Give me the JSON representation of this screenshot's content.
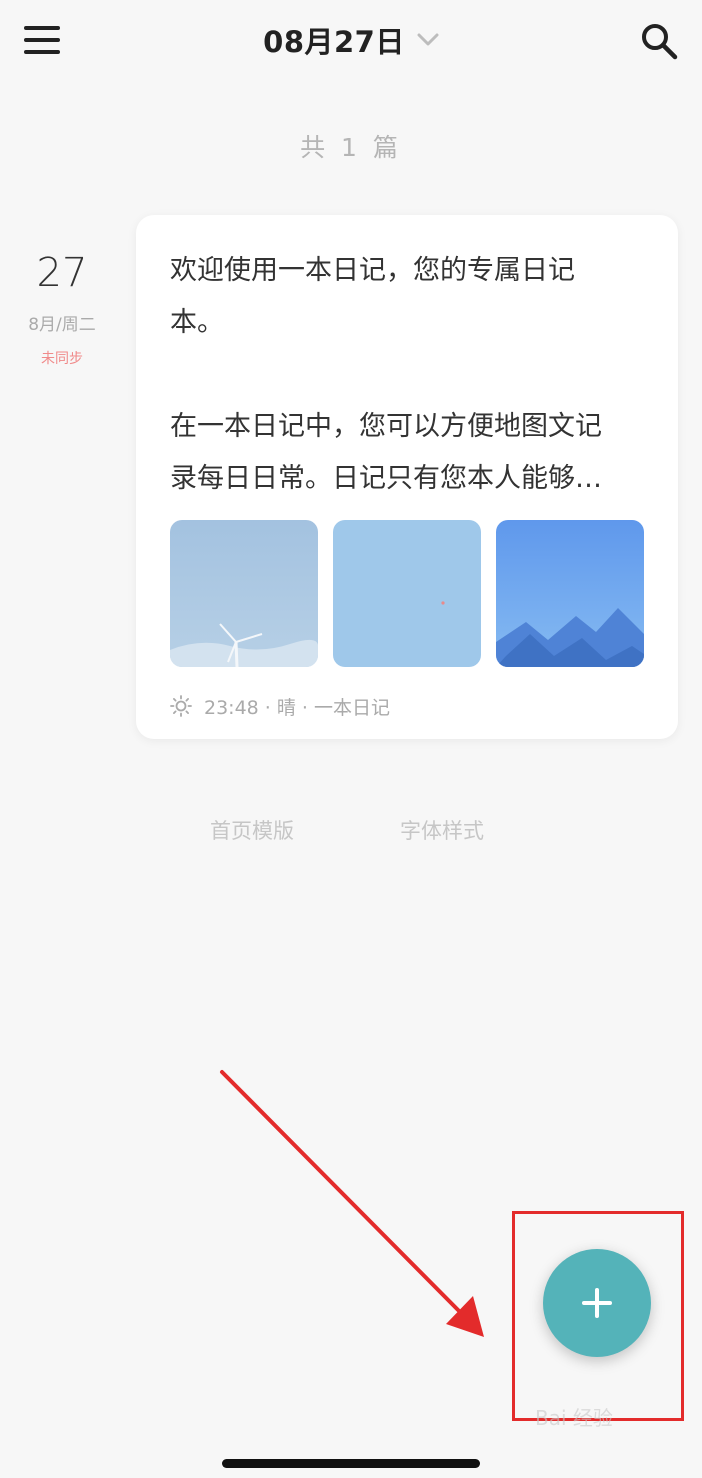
{
  "header": {
    "date_title": "08月27日",
    "menu_icon": "menu-icon",
    "search_icon": "search-icon"
  },
  "summary": {
    "count_text": "共 1 篇"
  },
  "entry": {
    "day": "27",
    "month_weekday": "8月/周二",
    "sync_status": "未同步",
    "paragraphs": [
      "欢迎使用一本日记，您的专属日记\n本。",
      "在一本日记中，您可以方便地图文记\n录每日日常。日记只有您本人能够…"
    ],
    "meta": "23:48 · 晴 · 一本日记",
    "weather_icon": "sun-icon"
  },
  "links": {
    "template": "首页模版",
    "font_style": "字体样式"
  },
  "fab": {
    "icon": "plus-icon"
  },
  "watermark": "Bai 经验",
  "colors": {
    "fab": "#54b3b9",
    "sync_status": "#f08a8a",
    "annotation": "#e32b2b"
  }
}
